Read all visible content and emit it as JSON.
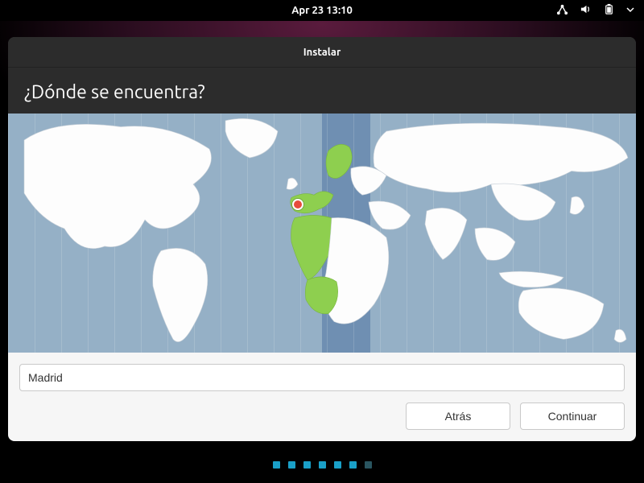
{
  "topbar": {
    "datetime": "Apr 23  13:10"
  },
  "window": {
    "title": "Instalar"
  },
  "page": {
    "heading": "¿Dónde se encuentra?",
    "timezone_value": "Madrid"
  },
  "buttons": {
    "back": "Atrás",
    "continue": "Continuar"
  },
  "progress": {
    "total": 7,
    "current": 6
  },
  "icons": {
    "network": "network-icon",
    "volume": "volume-icon",
    "battery": "battery-icon",
    "menu": "menu-caret-icon"
  },
  "map": {
    "selected_region": "Europe/Madrid timezone band",
    "marker_label": "Madrid"
  }
}
